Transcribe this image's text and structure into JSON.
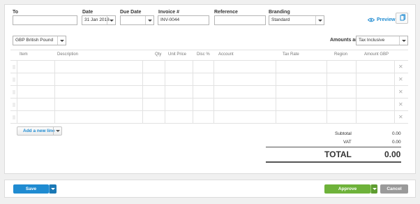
{
  "form": {
    "to_label": "To",
    "to_value": "",
    "date_label": "Date",
    "date_value": "31 Jan 2018",
    "due_date_label": "Due Date",
    "due_date_value": "",
    "invoice_label": "Invoice #",
    "invoice_value": "INV-0044",
    "reference_label": "Reference",
    "reference_value": "",
    "branding_label": "Branding",
    "branding_value": "Standard",
    "preview_label": "Preview"
  },
  "currency": {
    "value": "GBP British Pound"
  },
  "amounts": {
    "label": "Amounts are",
    "value": "Tax Inclusive"
  },
  "table": {
    "headers": {
      "item": "Item",
      "description": "Description",
      "qty": "Qty",
      "unit_price": "Unit Price",
      "disc": "Disc %",
      "account": "Account",
      "tax_rate": "Tax Rate",
      "region": "Region",
      "amount": "Amount GBP"
    },
    "rows": [
      {
        "item": "",
        "description": "",
        "qty": "",
        "unit_price": "",
        "disc": "",
        "account": "",
        "tax_rate": "",
        "region": "",
        "amount": ""
      },
      {
        "item": "",
        "description": "",
        "qty": "",
        "unit_price": "",
        "disc": "",
        "account": "",
        "tax_rate": "",
        "region": "",
        "amount": ""
      },
      {
        "item": "",
        "description": "",
        "qty": "",
        "unit_price": "",
        "disc": "",
        "account": "",
        "tax_rate": "",
        "region": "",
        "amount": ""
      },
      {
        "item": "",
        "description": "",
        "qty": "",
        "unit_price": "",
        "disc": "",
        "account": "",
        "tax_rate": "",
        "region": "",
        "amount": ""
      },
      {
        "item": "",
        "description": "",
        "qty": "",
        "unit_price": "",
        "disc": "",
        "account": "",
        "tax_rate": "",
        "region": "",
        "amount": ""
      }
    ],
    "remove_glyph": "✕"
  },
  "add_line": {
    "label": "Add a new line"
  },
  "totals": {
    "subtotal_label": "Subtotal",
    "subtotal_value": "0.00",
    "vat_label": "VAT",
    "vat_value": "0.00",
    "total_label": "TOTAL",
    "total_value": "0.00"
  },
  "footer": {
    "save_label": "Save",
    "approve_label": "Approve",
    "cancel_label": "Cancel"
  },
  "colors": {
    "save": "#1f8bd1",
    "approve": "#6eb23a",
    "cancel": "#9a9a9a",
    "link": "#1f8bd1"
  }
}
